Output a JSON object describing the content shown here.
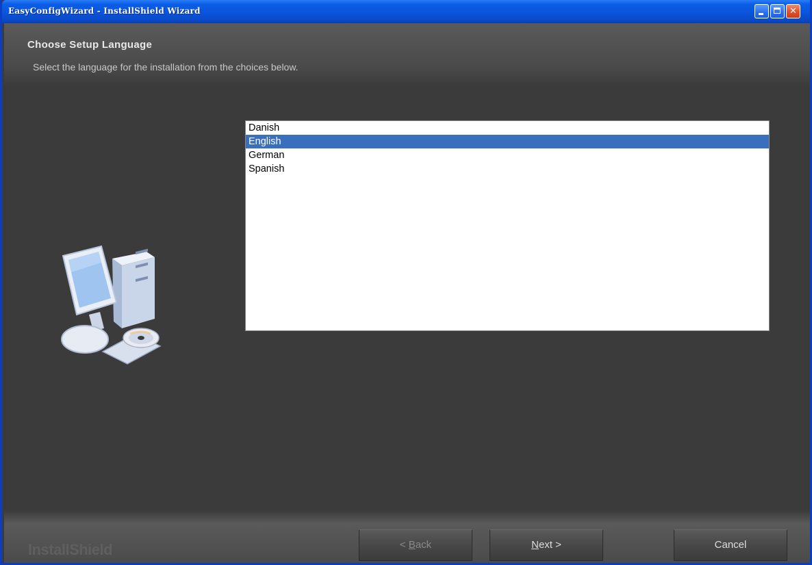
{
  "window": {
    "title": "EasyConfigWizard - InstallShield Wizard"
  },
  "header": {
    "title": "Choose Setup Language",
    "subtitle": "Select the language for the installation from the choices below."
  },
  "language_list": {
    "items": [
      "Danish",
      "English",
      "German",
      "Spanish"
    ],
    "selected": "English"
  },
  "footer": {
    "brand": "InstallShield",
    "back_prefix": "< ",
    "back_mnemonic": "B",
    "back_rest": "ack",
    "next_mnemonic": "N",
    "next_rest": "ext >",
    "cancel_label": "Cancel"
  },
  "colors": {
    "titlebar": "#0a55dc",
    "background": "#3b3b3b",
    "selection": "#3a6fbd"
  },
  "icons": [
    "minimize-icon",
    "maximize-icon",
    "close-icon",
    "computer-cd-illustration"
  ]
}
